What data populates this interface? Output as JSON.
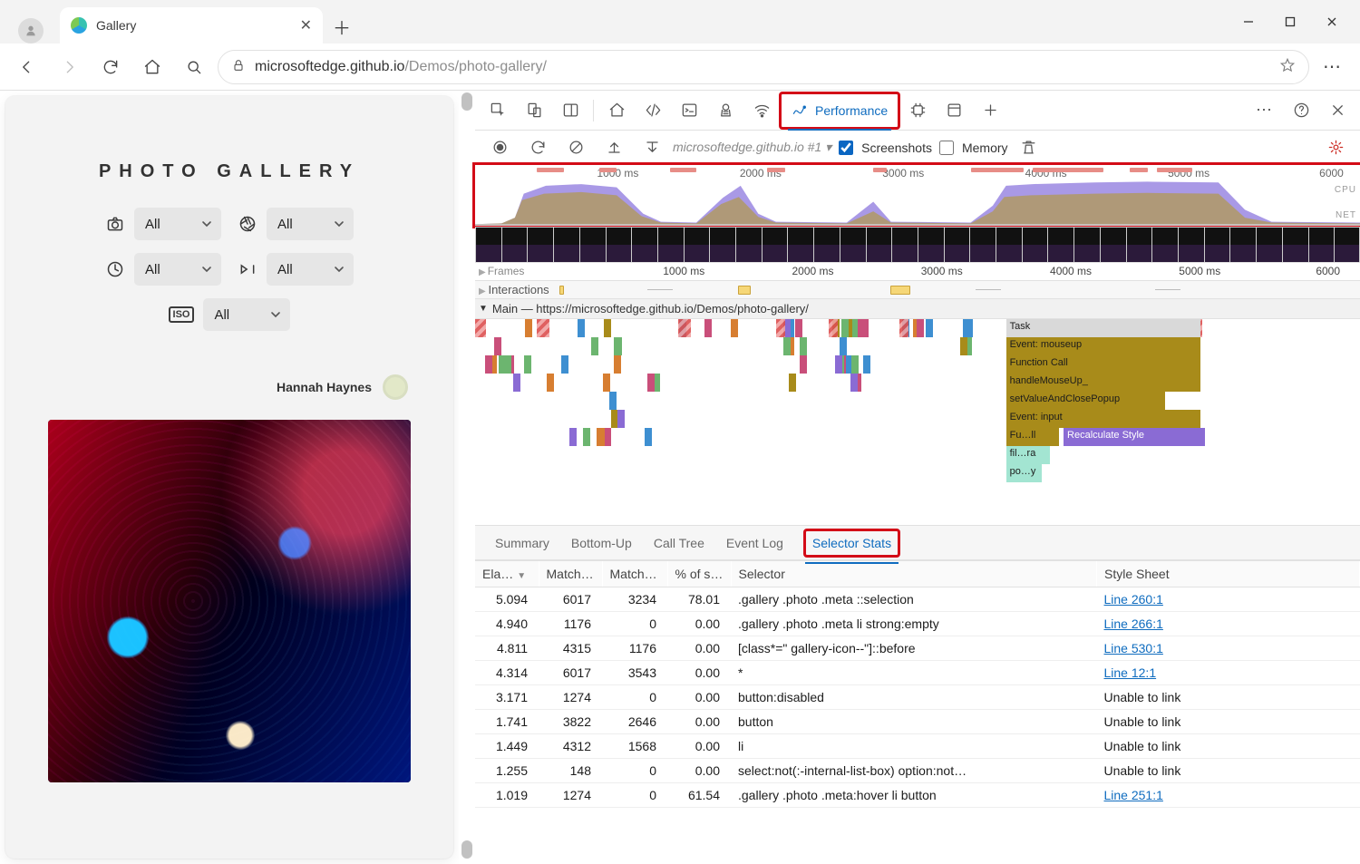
{
  "browser": {
    "tab_title": "Gallery",
    "url_host": "microsoftedge.github.io",
    "url_path": "/Demos/photo-gallery/"
  },
  "page": {
    "title": "PHOTO GALLERY",
    "filters": {
      "camera": "All",
      "aperture": "All",
      "exposure": "All",
      "focal": "All",
      "iso": "All",
      "iso_label": "ISO"
    },
    "user_name": "Hannah Haynes"
  },
  "devtools": {
    "active_panel": "Performance",
    "perf_toolbar": {
      "recording_label": "microsoftedge.github.io #1",
      "screenshots_label": "Screenshots",
      "screenshots_checked": true,
      "memory_label": "Memory",
      "memory_checked": false
    },
    "overview": {
      "ticks_ms": [
        "1000 ms",
        "2000 ms",
        "3000 ms",
        "4000 ms",
        "5000 ms",
        "6000"
      ],
      "cpu_label": "CPU",
      "net_label": "NET"
    },
    "ruler": {
      "ticks": [
        "1000 ms",
        "2000 ms",
        "3000 ms",
        "4000 ms",
        "5000 ms",
        "6000 m"
      ]
    },
    "tracks": {
      "frames_label": "Frames",
      "interactions_label": "Interactions",
      "main_label": "Main — https://microsoftedge.github.io/Demos/photo-gallery/"
    },
    "flame_stack": [
      "Task",
      "Event: mouseup",
      "Function Call",
      "handleMouseUp_",
      "setValueAndClosePopup",
      "Event: input",
      "Fu…ll",
      "Recalculate Style",
      "fil…ra",
      "po…y"
    ],
    "detail_tabs": [
      "Summary",
      "Bottom-Up",
      "Call Tree",
      "Event Log",
      "Selector Stats"
    ],
    "detail_active": "Selector Stats",
    "columns": [
      "Ela…",
      "Match …",
      "Match …",
      "% of sl…",
      "Selector",
      "Style Sheet"
    ],
    "rows": [
      {
        "elapsed": "5.094",
        "attempts": "6017",
        "count": "3234",
        "pct": "78.01",
        "selector": ".gallery .photo .meta ::selection",
        "sheet": "Line 260:1",
        "link": true
      },
      {
        "elapsed": "4.940",
        "attempts": "1176",
        "count": "0",
        "pct": "0.00",
        "selector": ".gallery .photo .meta li strong:empty",
        "sheet": "Line 266:1",
        "link": true
      },
      {
        "elapsed": "4.811",
        "attempts": "4315",
        "count": "1176",
        "pct": "0.00",
        "selector": "[class*=\" gallery-icon--\"]::before",
        "sheet": "Line 530:1",
        "link": true
      },
      {
        "elapsed": "4.314",
        "attempts": "6017",
        "count": "3543",
        "pct": "0.00",
        "selector": "*",
        "sheet": "Line 12:1",
        "link": true
      },
      {
        "elapsed": "3.171",
        "attempts": "1274",
        "count": "0",
        "pct": "0.00",
        "selector": "button:disabled",
        "sheet": "Unable to link",
        "link": false
      },
      {
        "elapsed": "1.741",
        "attempts": "3822",
        "count": "2646",
        "pct": "0.00",
        "selector": "button",
        "sheet": "Unable to link",
        "link": false
      },
      {
        "elapsed": "1.449",
        "attempts": "4312",
        "count": "1568",
        "pct": "0.00",
        "selector": "li",
        "sheet": "Unable to link",
        "link": false
      },
      {
        "elapsed": "1.255",
        "attempts": "148",
        "count": "0",
        "pct": "0.00",
        "selector": "select:not(:-internal-list-box) option:not…",
        "sheet": "Unable to link",
        "link": false
      },
      {
        "elapsed": "1.019",
        "attempts": "1274",
        "count": "0",
        "pct": "61.54",
        "selector": ".gallery .photo .meta:hover li button",
        "sheet": "Line 251:1",
        "link": true
      }
    ]
  }
}
